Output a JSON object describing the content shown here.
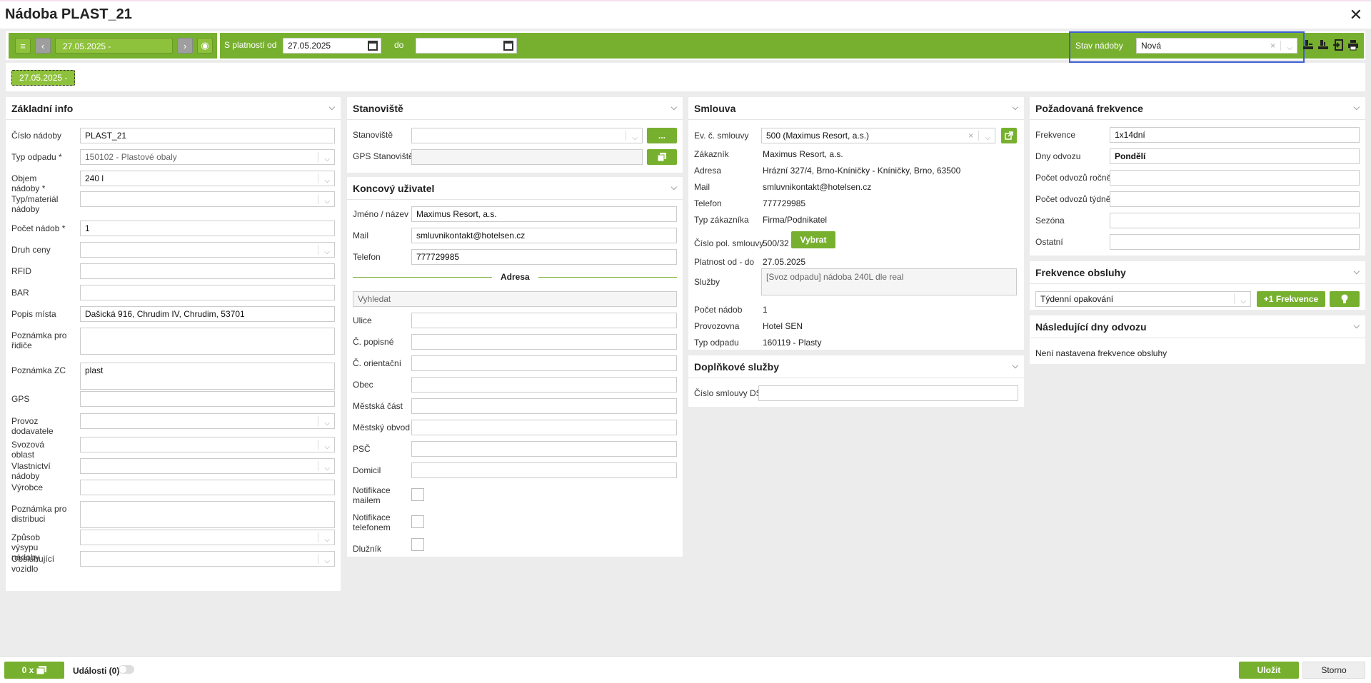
{
  "window": {
    "title": "Nádoba PLAST_21",
    "close": "✕"
  },
  "toolbar": {
    "menu_icon": "≡",
    "prev_icon": "‹",
    "next_icon": "›",
    "period_label": "27.05.2025 -",
    "eye_icon": "◉",
    "valid_from_label": "S platností od",
    "valid_from_value": "27.05.2025",
    "to_label": "do",
    "to_value": "",
    "status_label": "Stav nádoby",
    "status_value": "Nová",
    "status_clear": "×",
    "status_arrow": "⌵",
    "icons": [
      "stamp-in-icon",
      "stamp-out-icon",
      "export-icon",
      "print-icon"
    ]
  },
  "subbar": {
    "chip": "27.05.2025 -"
  },
  "zakladni": {
    "title": "Základní info",
    "fields": [
      {
        "label": "Číslo nádoby",
        "value": "PLAST_21"
      },
      {
        "label": "Typ odpadu *",
        "value": "150102 - Plastové obaly"
      },
      {
        "label": "Objem nádoby *",
        "value": "240 l"
      },
      {
        "label": "Typ/materiál nádoby",
        "value": ""
      },
      {
        "label": "Počet nádob *",
        "value": "1"
      },
      {
        "label": "Druh ceny",
        "value": ""
      },
      {
        "label": "RFID",
        "value": ""
      },
      {
        "label": "BAR",
        "value": ""
      },
      {
        "label": "Popis místa",
        "value": "Dašická 916, Chrudim IV, Chrudim, 53701"
      },
      {
        "label": "Poznámka pro řidiče",
        "value": ""
      },
      {
        "label": "Poznámka ZC",
        "value": "plast"
      },
      {
        "label": "GPS",
        "value": ""
      },
      {
        "label": "Provoz dodavatele",
        "value": ""
      },
      {
        "label": "Svozová oblast",
        "value": ""
      },
      {
        "label": "Vlastnictví nádoby",
        "value": ""
      },
      {
        "label": "Výrobce",
        "value": ""
      },
      {
        "label": "Poznámka pro distribuci",
        "value": ""
      },
      {
        "label": "Způsob výsypu nádoby",
        "value": ""
      },
      {
        "label": "Obsluhující vozidlo",
        "value": ""
      }
    ]
  },
  "stanoviste": {
    "title": "Stanoviště",
    "label1": "Stanoviště",
    "value1": "",
    "btn1": "...",
    "label2": "GPS Stanoviště",
    "value2": ""
  },
  "koncovy": {
    "title": "Koncový uživatel",
    "name_label": "Jméno / název",
    "name_value": "Maximus Resort, a.s.",
    "mail_label": "Mail",
    "mail_value": "smluvnikontakt@hotelsen.cz",
    "phone_label": "Telefon",
    "phone_value": "777729985",
    "address_title": "Adresa",
    "search_placeholder": "Vyhledat",
    "addr_fields": [
      "Ulice",
      "Č. popisné",
      "Č. orientační",
      "Obec",
      "Městská část",
      "Městský obvod",
      "PSČ",
      "Domicil"
    ],
    "notif_mail": "Notifikace mailem",
    "notif_phone": "Notifikace telefonem",
    "debtor": "Dlužník"
  },
  "smlouva": {
    "title": "Smlouva",
    "ev_label": "Ev. č. smlouvy",
    "ev_value": "500 (Maximus Resort, a.s.)",
    "rows": [
      {
        "label": "Zákazník",
        "value": "Maximus Resort, a.s."
      },
      {
        "label": "Adresa",
        "value": "Hrázní 327/4, Brno-Kníničky - Kníničky, Brno, 63500"
      },
      {
        "label": "Mail",
        "value": "smluvnikontakt@hotelsen.cz"
      },
      {
        "label": "Telefon",
        "value": "777729985"
      },
      {
        "label": "Typ zákazníka",
        "value": "Firma/Podnikatel"
      }
    ],
    "pol_label": "Číslo pol. smlouvy",
    "pol_value": "500/32",
    "pol_btn": "Vybrat",
    "platnost_label": "Platnost od - do",
    "platnost_value": "27.05.2025",
    "sluzby_label": "Služby",
    "sluzby_value": "[Svoz odpadu]  nádoba 240L dle real",
    "rows2": [
      {
        "label": "Počet nádob",
        "value": "1"
      },
      {
        "label": "Provozovna",
        "value": "Hotel SEN"
      },
      {
        "label": "Typ odpadu",
        "value": "160119 - Plasty"
      }
    ]
  },
  "doplnkove": {
    "title": "Doplňkové služby",
    "label": "Číslo smlouvy DS",
    "value": ""
  },
  "frekvence": {
    "title": "Požadovaná frekvence",
    "fields": [
      {
        "label": "Frekvence",
        "value": "1x14dní"
      },
      {
        "label": "Dny odvozu",
        "value": "Pondělí"
      },
      {
        "label": "Počet odvozů ročně",
        "value": ""
      },
      {
        "label": "Počet odvozů týdně",
        "value": ""
      },
      {
        "label": "Sezóna",
        "value": ""
      },
      {
        "label": "Ostatní",
        "value": ""
      }
    ]
  },
  "obsluhy": {
    "title": "Frekvence obsluhy",
    "select_value": "Týdenní opakování",
    "add_btn": "+1 Frekvence",
    "bulb": "💡"
  },
  "nasledujici": {
    "title": "Následující dny odvozu",
    "text": "Není nastavena frekvence obsluhy"
  },
  "footer": {
    "attach_btn": "0 x",
    "events_label": "Události (0)",
    "save": "Uložit",
    "cancel": "Storno"
  }
}
